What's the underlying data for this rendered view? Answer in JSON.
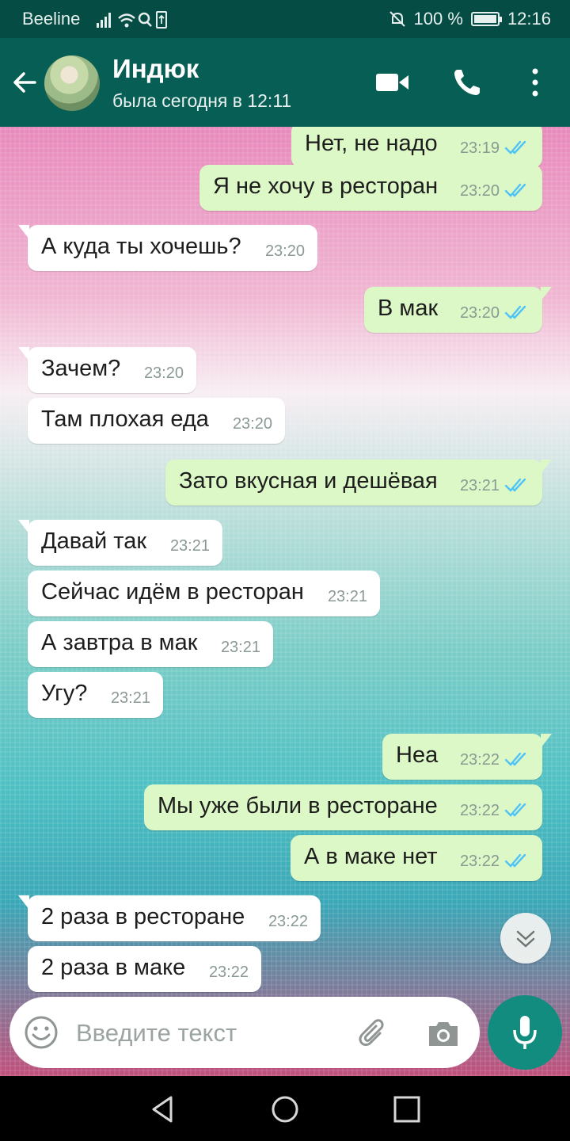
{
  "status_bar": {
    "carrier": "Beeline",
    "battery": "100 %",
    "battery_level": 1.0,
    "time": "12:16"
  },
  "header": {
    "contact_name": "Индюк",
    "last_seen": "была сегодня в 12:11",
    "icons": [
      "back-arrow-icon",
      "avatar",
      "video-call-icon",
      "phone-icon",
      "more-vertical-icon"
    ]
  },
  "messages": [
    {
      "dir": "out",
      "text": "Нет, не надо",
      "time": "23:19",
      "read": true
    },
    {
      "dir": "out",
      "text": "Я не хочу в ресторан",
      "time": "23:20",
      "read": true
    },
    {
      "dir": "in",
      "text": "А куда ты хочешь?",
      "time": "23:20"
    },
    {
      "dir": "out",
      "text": "В мак",
      "time": "23:20",
      "read": true
    },
    {
      "dir": "in",
      "text": "Зачем?",
      "time": "23:20"
    },
    {
      "dir": "in",
      "text": "Там плохая еда",
      "time": "23:20"
    },
    {
      "dir": "out",
      "text": "Зато вкусная и дешёвая",
      "time": "23:21",
      "read": true
    },
    {
      "dir": "in",
      "text": "Давай так",
      "time": "23:21"
    },
    {
      "dir": "in",
      "text": "Сейчас идём в ресторан",
      "time": "23:21"
    },
    {
      "dir": "in",
      "text": "А завтра в мак",
      "time": "23:21"
    },
    {
      "dir": "in",
      "text": "Угу?",
      "time": "23:21"
    },
    {
      "dir": "out",
      "text": "Неа",
      "time": "23:22",
      "read": true
    },
    {
      "dir": "out",
      "text": "Мы уже были в ресторане",
      "time": "23:22",
      "read": true
    },
    {
      "dir": "out",
      "text": "А в маке нет",
      "time": "23:22",
      "read": true
    },
    {
      "dir": "in",
      "text": "2 раза в ресторане",
      "time": "23:22"
    },
    {
      "dir": "in",
      "text": "2 раза в маке",
      "time": "23:22"
    }
  ],
  "input": {
    "placeholder": "Введите текст"
  },
  "colors": {
    "header": "#075e54",
    "status_bar": "#054d44",
    "outgoing_bubble": "#dcf8c6",
    "incoming_bubble": "#ffffff",
    "read_ticks": "#4fc3f7",
    "mic_button": "#128c7e"
  }
}
